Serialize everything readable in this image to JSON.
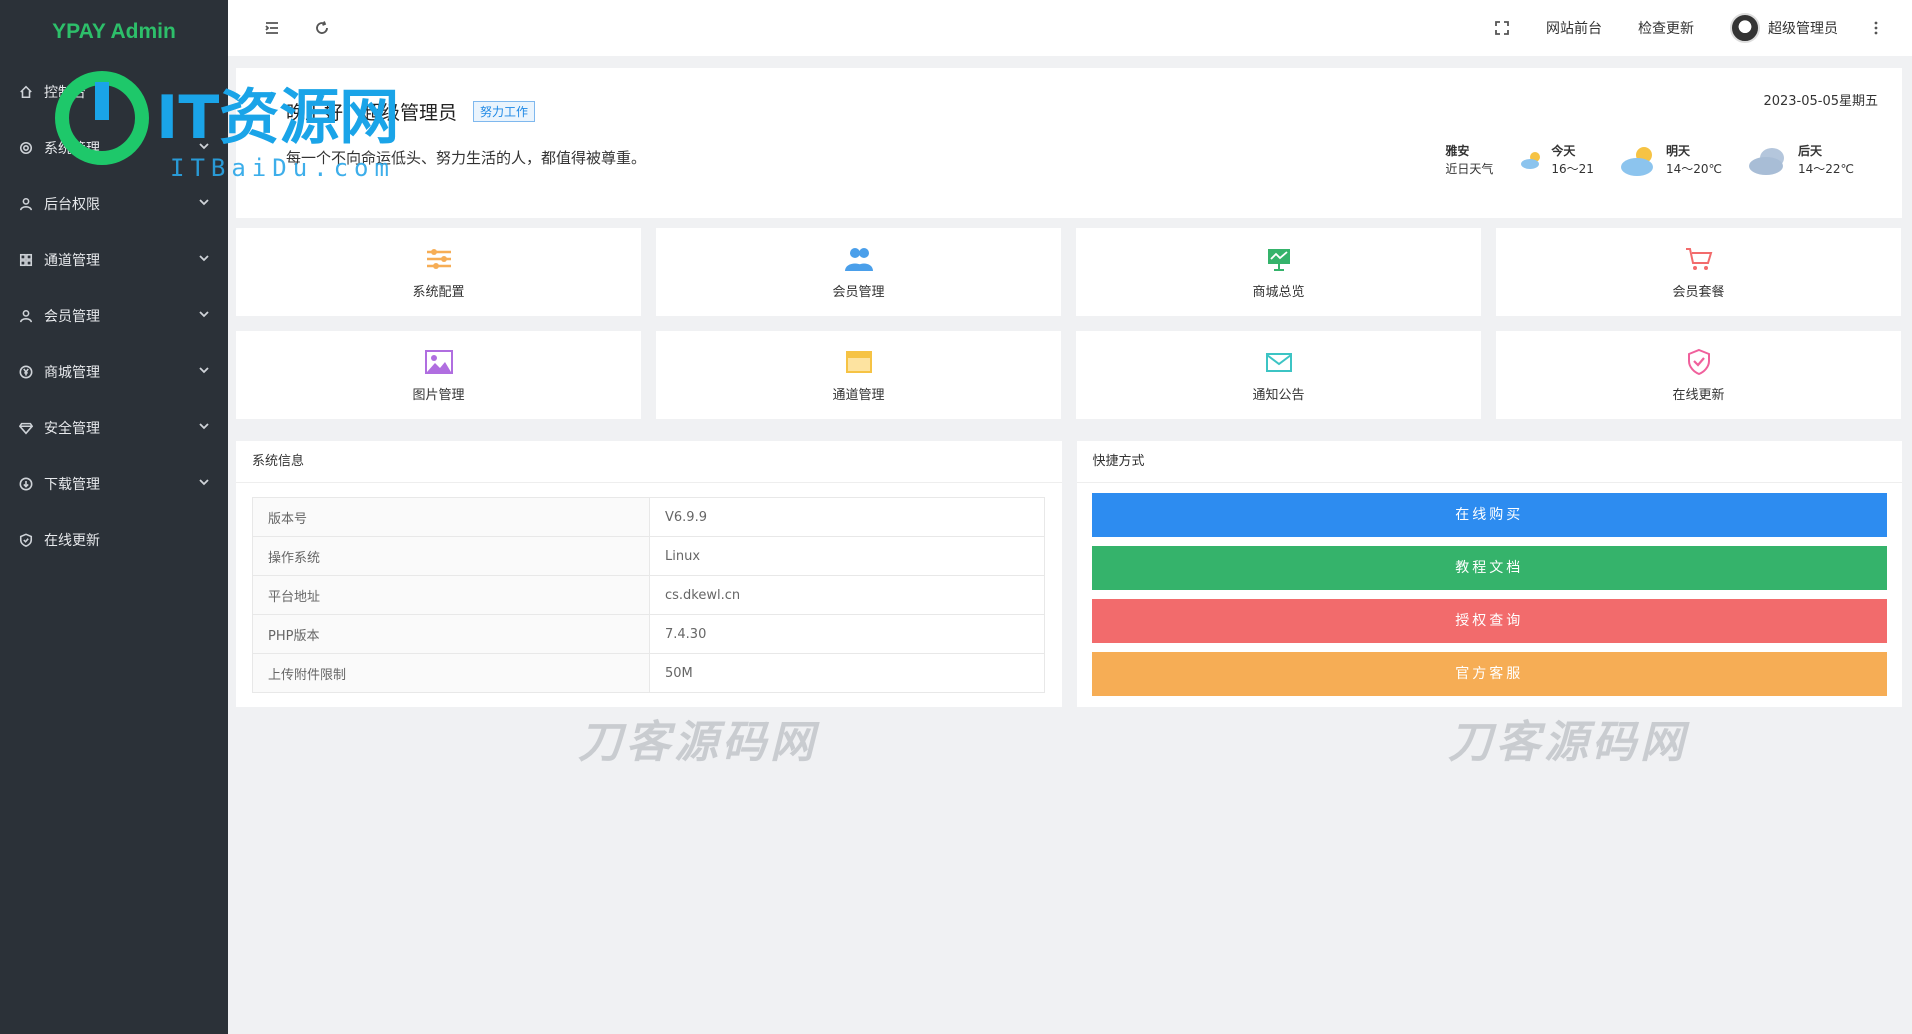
{
  "sidebar": {
    "brand": "YPAY Admin",
    "items": [
      {
        "label": "控制台",
        "icon": "home-icon",
        "has_arrow": false
      },
      {
        "label": "系统管理",
        "icon": "gear-icon",
        "has_arrow": true
      },
      {
        "label": "后台权限",
        "icon": "user-icon",
        "has_arrow": true
      },
      {
        "label": "通道管理",
        "icon": "grid-icon",
        "has_arrow": true
      },
      {
        "label": "会员管理",
        "icon": "user-icon",
        "has_arrow": true
      },
      {
        "label": "商城管理",
        "icon": "yen-icon",
        "has_arrow": true
      },
      {
        "label": "安全管理",
        "icon": "diamond-icon",
        "has_arrow": true
      },
      {
        "label": "下载管理",
        "icon": "download-icon",
        "has_arrow": true
      },
      {
        "label": "在线更新",
        "icon": "shield-icon",
        "has_arrow": false
      }
    ]
  },
  "header": {
    "links": [
      "网站前台",
      "检查更新"
    ],
    "user_name": "超级管理员"
  },
  "welcome": {
    "title": "晚上好，超级管理员",
    "tag": "努力工作",
    "motto": "每一个不向命运低头、努力生活的人，都值得被尊重。",
    "date": "2023-05-05星期五",
    "weather": {
      "location": "雅安",
      "caption": "近日天气",
      "days": [
        {
          "label": "今天",
          "temp": "16～21",
          "icon": "cloudy-sun-icon"
        },
        {
          "label": "明天",
          "temp": "14～20℃",
          "icon": "sun-cloud-icon"
        },
        {
          "label": "后天",
          "temp": "14～22℃",
          "icon": "cloud-icon"
        }
      ]
    }
  },
  "tiles": [
    {
      "label": "系统配置",
      "icon": "sliders-icon",
      "color": "#f6ad55"
    },
    {
      "label": "会员管理",
      "icon": "users-icon",
      "color": "#4a9fea"
    },
    {
      "label": "商城总览",
      "icon": "board-icon",
      "color": "#35b36b"
    },
    {
      "label": "会员套餐",
      "icon": "cart-icon",
      "color": "#f26b6c"
    },
    {
      "label": "图片管理",
      "icon": "image-icon",
      "color": "#b06ee0"
    },
    {
      "label": "通道管理",
      "icon": "window-icon",
      "color": "#f6c344"
    },
    {
      "label": "通知公告",
      "icon": "mail-icon",
      "color": "#3cc4c4"
    },
    {
      "label": "在线更新",
      "icon": "shield-check-icon",
      "color": "#f0609c"
    }
  ],
  "system_info": {
    "title": "系统信息",
    "rows": [
      {
        "key": "版本号",
        "value": "V6.9.9"
      },
      {
        "key": "操作系统",
        "value": "Linux"
      },
      {
        "key": "平台地址",
        "value": "cs.dkewl.cn"
      },
      {
        "key": "PHP版本",
        "value": "7.4.30"
      },
      {
        "key": "上传附件限制",
        "value": "50M"
      }
    ]
  },
  "shortcuts": {
    "title": "快捷方式",
    "buttons": [
      {
        "label": "在线购买",
        "color": "#2d8cf0"
      },
      {
        "label": "教程文档",
        "color": "#35b36b"
      },
      {
        "label": "授权查询",
        "color": "#f26b6c"
      },
      {
        "label": "官方客服",
        "color": "#f6ad55"
      }
    ]
  },
  "watermarks": {
    "logo": "IT资源网",
    "logo_sub": "ITBaiDu.com",
    "footer": "刀客源码网"
  }
}
